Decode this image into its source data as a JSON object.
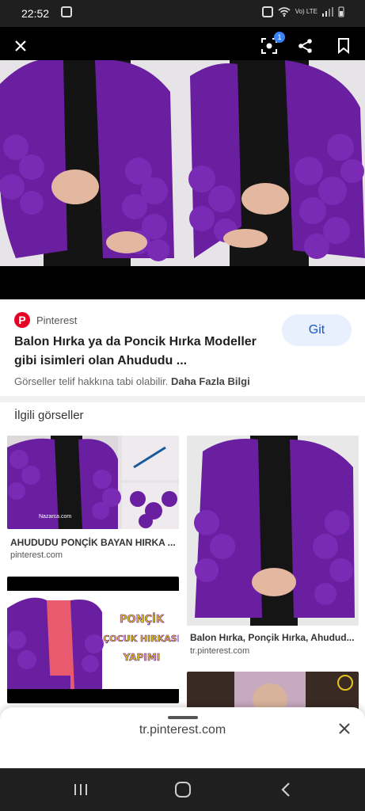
{
  "status_bar": {
    "time": "22:52",
    "network": "Vo) LTE"
  },
  "toolbar": {
    "lens_badge": "1"
  },
  "result": {
    "source": "Pinterest",
    "title": "Balon Hırka ya da Poncik Hırka Modeller gibi isimleri olan Ahududu ...",
    "visit_label": "Git",
    "copyright_text": "Görseller telif hakkına tabi olabilir.",
    "more_info": "Daha Fazla Bilgi"
  },
  "related": {
    "heading": "İlgili görseller",
    "items": [
      {
        "title": "AHUDUDU PONÇİK BAYAN HIRKA ...",
        "source": "pinterest.com"
      },
      {
        "title": "Balon Hırka, Ponçik Hırka, Ahudud...",
        "source": "tr.pinterest.com"
      },
      {
        "overlay_lines": [
          "PONÇİK",
          "ÇOCUK HIRKASI",
          "YAPIMI"
        ]
      }
    ],
    "watermark": "Nazarca.com"
  },
  "sheet": {
    "url": "tr.pinterest.com"
  },
  "colors": {
    "purple": "#6a1fa0",
    "pinterest_red": "#e60023",
    "visit_bg": "#e8f0fe"
  }
}
